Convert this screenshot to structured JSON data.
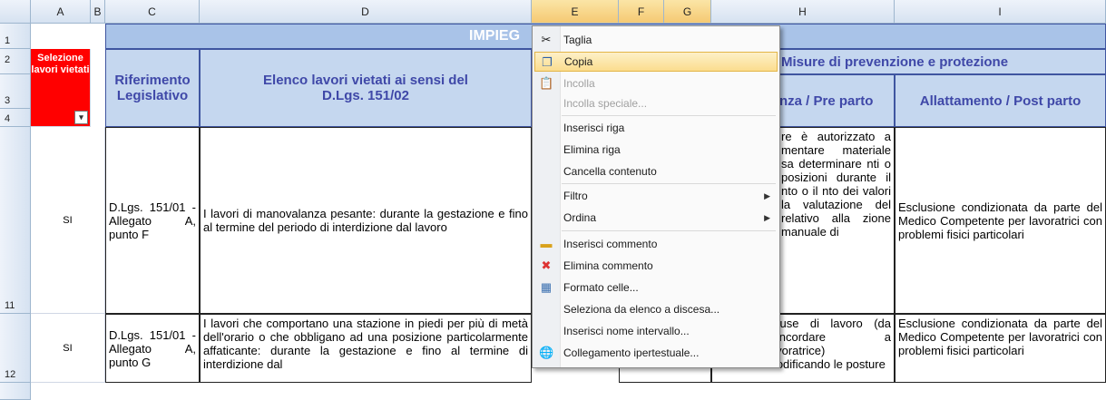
{
  "columns": [
    "A",
    "B",
    "C",
    "D",
    "E",
    "F",
    "G",
    "H",
    "I"
  ],
  "rows": [
    "1",
    "2",
    "3",
    "4",
    "11",
    "12"
  ],
  "sheet": {
    "title_partial": "IMPIEG",
    "misure_header": "Misure di prevenzione e protezione",
    "selezione_header": "Selezione lavori vietati",
    "riferimento_header": "Riferimento Legislativo",
    "elenco_header": "Elenco lavori vietati ai sensi del D.Lgs. 151/02",
    "preparto_header": "nza / Pre parto",
    "allattamento_header": "Allattamento / Post parto",
    "row11": {
      "sel": "SI",
      "rif": "D.Lgs. 151/01 - Allegato A, punto F",
      "elenco": "I lavori di manovalanza pesante: durante la gestazione e fino al termine del periodo di interdizione dal lavoro",
      "preparto": "re è autorizzato a mentare materiale sa determinare nti o posizioni durante il nto o il nto dei valori la valutazione del relativo alla zione manuale di",
      "allattamento": "Esclusione condizionata da parte del Medico Competente per lavoratrici con problemi fisici particolari"
    },
    "row12": {
      "sel": "SI",
      "rif": "D.Lgs. 151/01 - Allegato A, punto G",
      "elenco": "I lavori che comportano una stazione in piedi per più di metà dell'orario o che obbligano ad una posizione particolarmente affaticante: durante la gestazione e fino al termine di interdizione dal",
      "preparto": "pause di lavoro (da concordare a lavoratrice) modificando le posture",
      "allattamento": "Esclusione condizionata da parte del Medico Competente per lavoratrici con problemi fisici particolari"
    }
  },
  "context_menu": {
    "items": [
      {
        "label": "Taglia",
        "icon": "scissors-icon"
      },
      {
        "label": "Copia",
        "icon": "copy-icon"
      },
      {
        "label": "Incolla",
        "icon": "paste-icon"
      },
      {
        "label": "Incolla speciale...",
        "icon": ""
      },
      {
        "label": "Inserisci riga",
        "icon": ""
      },
      {
        "label": "Elimina riga",
        "icon": ""
      },
      {
        "label": "Cancella contenuto",
        "icon": ""
      },
      {
        "label": "Filtro",
        "icon": ""
      },
      {
        "label": "Ordina",
        "icon": ""
      },
      {
        "label": "Inserisci commento",
        "icon": "comment-insert-icon"
      },
      {
        "label": "Elimina commento",
        "icon": "comment-delete-icon"
      },
      {
        "label": "Formato celle...",
        "icon": "format-cells-icon"
      },
      {
        "label": "Seleziona da elenco a discesa...",
        "icon": ""
      },
      {
        "label": "Inserisci nome intervallo...",
        "icon": ""
      },
      {
        "label": "Collegamento ipertestuale...",
        "icon": "hyperlink-icon"
      }
    ]
  }
}
